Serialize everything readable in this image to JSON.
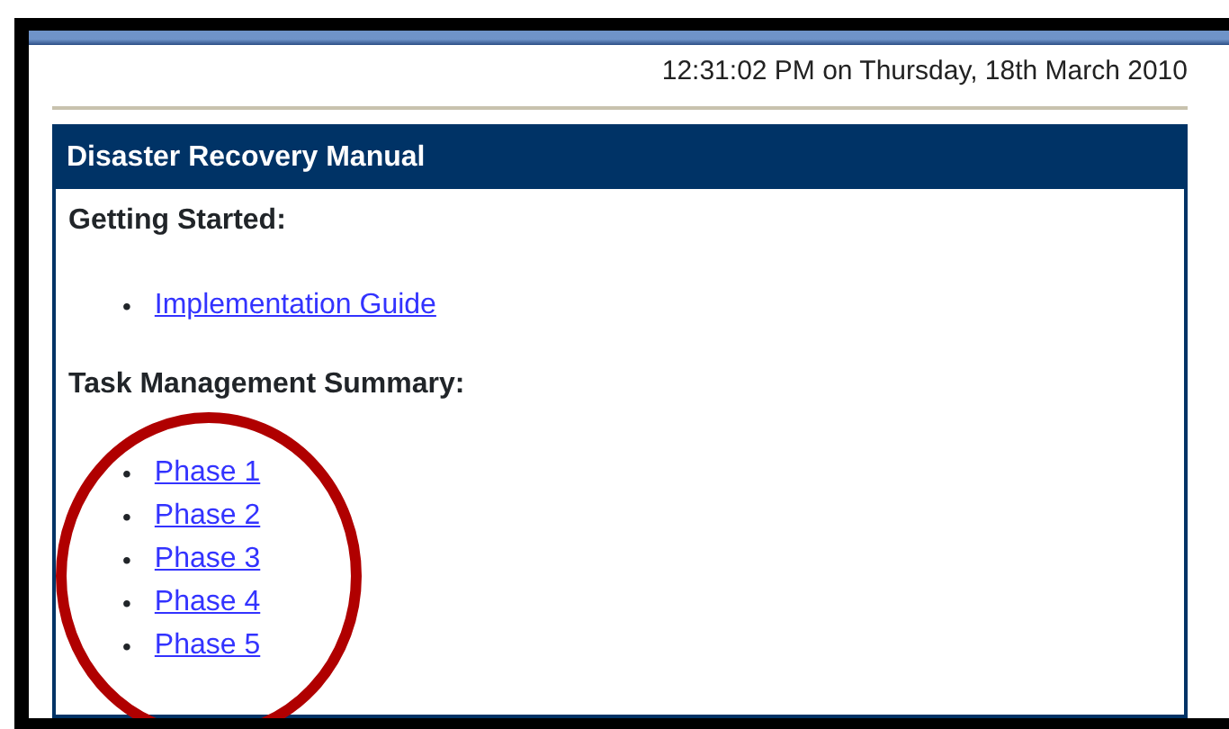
{
  "timestamp": "12:31:02 PM on Thursday, 18th March 2010",
  "panel": {
    "title": "Disaster Recovery Manual",
    "sections": [
      {
        "heading": "Getting Started:",
        "links": [
          {
            "bullet": "•",
            "label": "Implementation Guide"
          }
        ]
      },
      {
        "heading": "Task Management Summary:",
        "links": [
          {
            "bullet": "•",
            "label": "Phase 1"
          },
          {
            "bullet": "•",
            "label": "Phase 2"
          },
          {
            "bullet": "•",
            "label": "Phase 3"
          },
          {
            "bullet": "•",
            "label": "Phase 4"
          },
          {
            "bullet": "•",
            "label": "Phase 5"
          }
        ]
      }
    ]
  }
}
